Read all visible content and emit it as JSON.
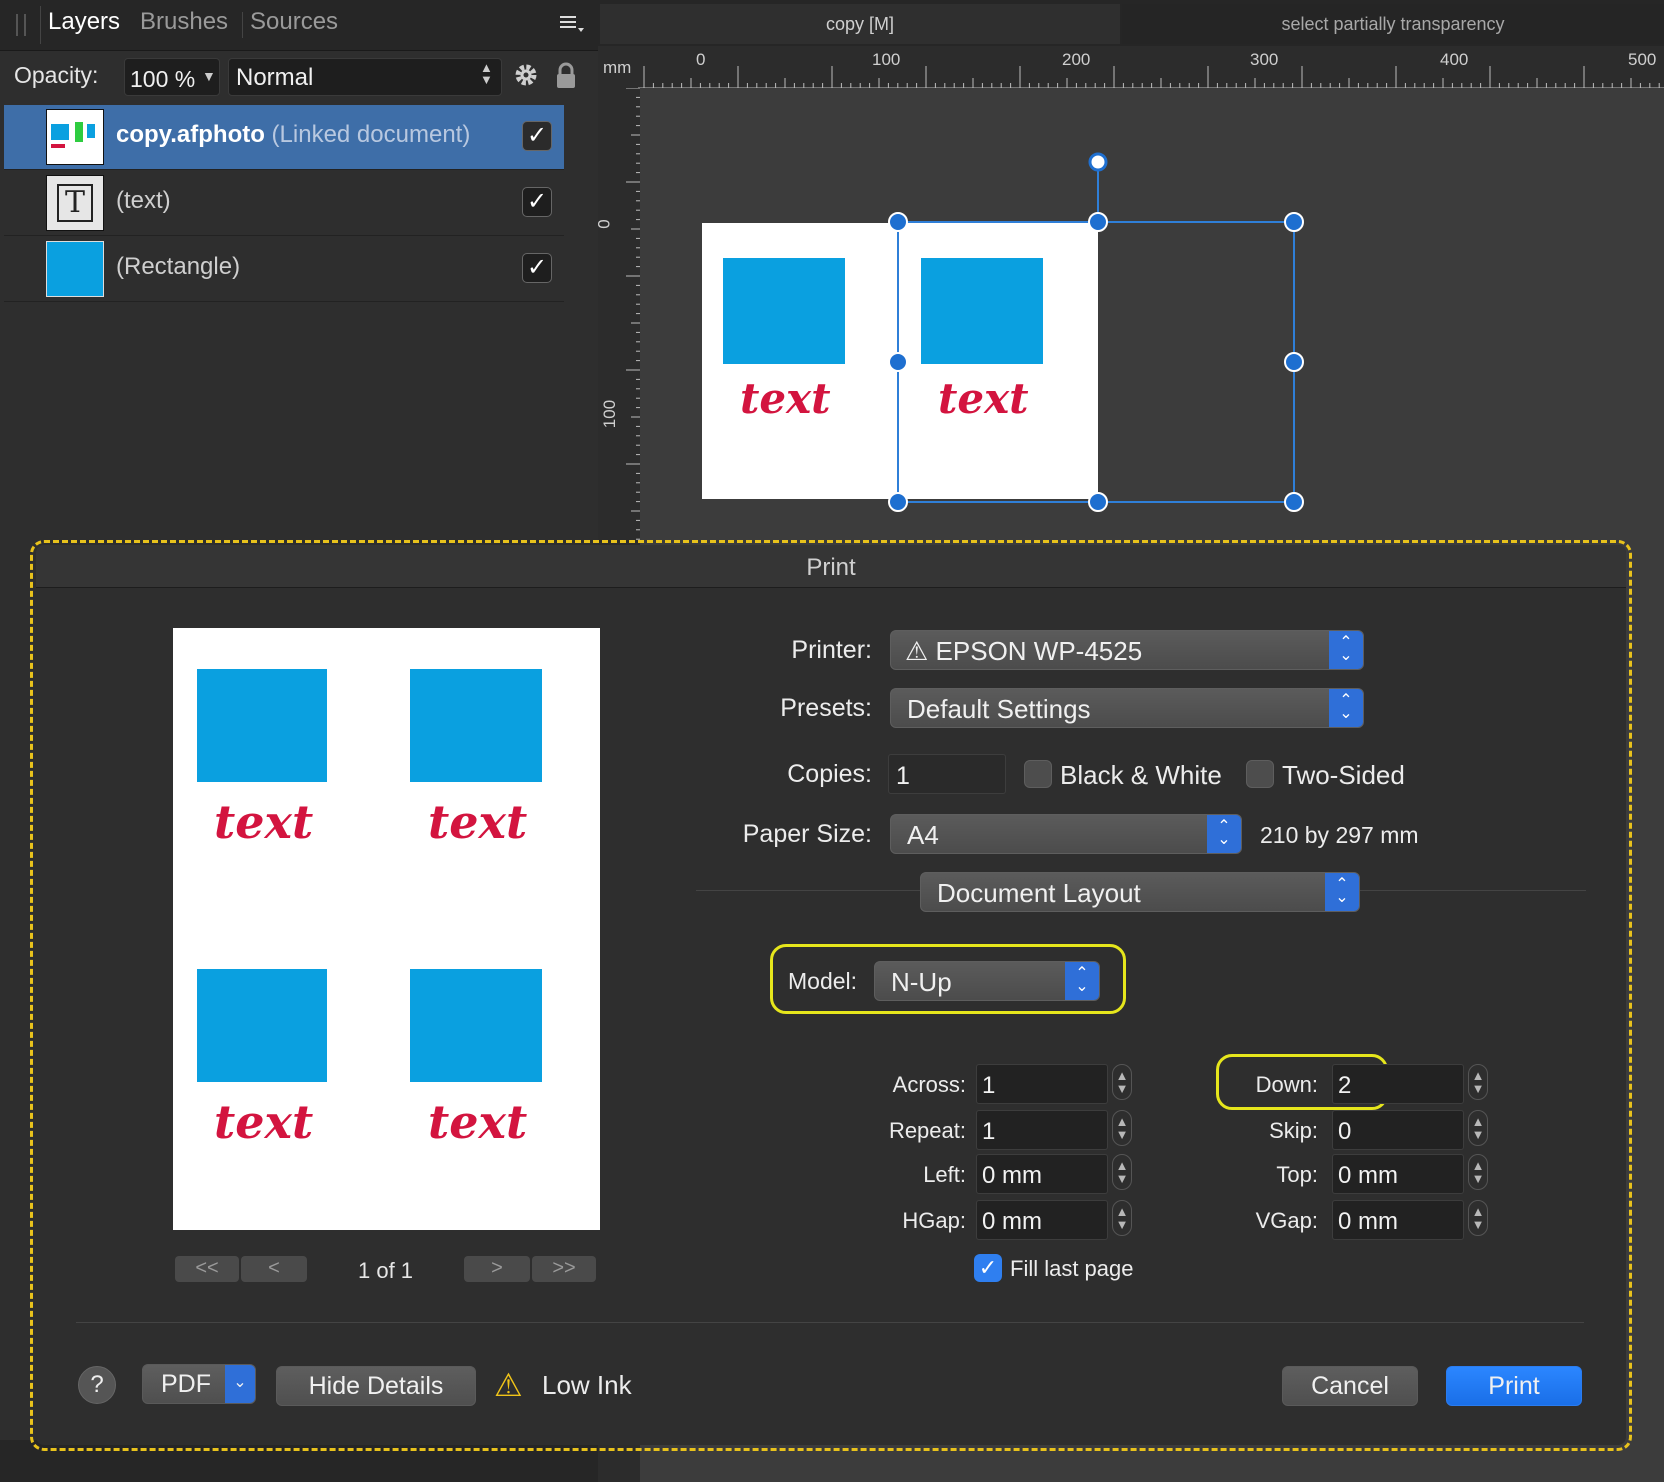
{
  "layers_panel": {
    "tabs": [
      "Layers",
      "Brushes",
      "Sources"
    ],
    "opacity_label": "Opacity:",
    "opacity_value": "100 %",
    "blend_mode": "Normal",
    "layers": [
      {
        "name": "copy.afphoto",
        "suffix": "(Linked document)",
        "visible_checked": "✓",
        "selected": true
      },
      {
        "name": "(text)",
        "visible_checked": "✓",
        "selected": false
      },
      {
        "name": "(Rectangle)",
        "visible_checked": "✓",
        "selected": false
      }
    ]
  },
  "document_tabs": [
    "copy [M]",
    "select partially transparency"
  ],
  "ruler": {
    "unit": "mm",
    "horizontal_labels": [
      "0",
      "100",
      "200",
      "300",
      "400",
      "500"
    ],
    "vertical_labels": [
      "0",
      "100"
    ]
  },
  "canvas": {
    "artwork_text": "text"
  },
  "print_dialog": {
    "title": "Print",
    "printer_label": "Printer:",
    "printer_value": "EPSON WP-4525",
    "presets_label": "Presets:",
    "presets_value": "Default Settings",
    "copies_label": "Copies:",
    "copies_value": "1",
    "black_white_label": "Black & White",
    "two_sided_label": "Two-Sided",
    "paper_size_label": "Paper Size:",
    "paper_size_value": "A4",
    "paper_dimensions": "210 by 297 mm",
    "section_value": "Document Layout",
    "model_label": "Model:",
    "model_value": "N-Up",
    "across_label": "Across:",
    "across_value": "1",
    "down_label": "Down:",
    "down_value": "2",
    "repeat_label": "Repeat:",
    "repeat_value": "1",
    "skip_label": "Skip:",
    "skip_value": "0",
    "left_label": "Left:",
    "left_value": "0 mm",
    "top_label": "Top:",
    "top_value": "0 mm",
    "hgap_label": "HGap:",
    "hgap_value": "0 mm",
    "vgap_label": "VGap:",
    "vgap_value": "0 mm",
    "fill_last_page_label": "Fill last page",
    "fill_last_page_checked": true,
    "preview_page_indicator": "1 of 1",
    "preview_text": "text",
    "help_label": "?",
    "pdf_label": "PDF",
    "hide_details_label": "Hide Details",
    "low_ink_label": "Low Ink",
    "cancel_label": "Cancel",
    "print_label": "Print"
  },
  "colors": {
    "accent_blue": "#2f6fd8",
    "artwork_blue": "#0aa0e0",
    "artwork_red": "#d3143f",
    "highlight_yellow": "#e6e61c",
    "outline_dash_yellow": "#e8c21c"
  }
}
